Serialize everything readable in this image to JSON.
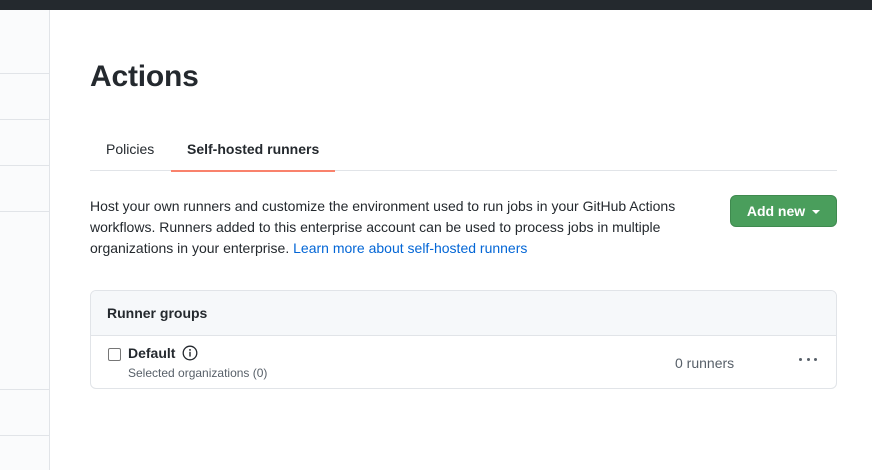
{
  "page": {
    "title": "Actions"
  },
  "tabs": [
    {
      "label": "Policies"
    },
    {
      "label": "Self-hosted runners"
    }
  ],
  "intro": {
    "text": "Host your own runners and customize the environment used to run jobs in your GitHub Actions workflows. Runners added to this enterprise account can be used to process jobs in multiple organizations in your enterprise.",
    "link": "Learn more about self-hosted runners"
  },
  "add_button": {
    "label": "Add new",
    "color": "#4a9e5c"
  },
  "runner_groups": {
    "header": "Runner groups",
    "rows": [
      {
        "name": "Default",
        "subtitle": "Selected organizations (0)",
        "count": "0 runners",
        "checked": false
      }
    ]
  },
  "colors": {
    "accent_underline": "#f9826c",
    "link": "#0366d6",
    "topbar": "#24292e"
  },
  "icons": [
    "info-icon",
    "caret-down-icon",
    "kebab-horizontal-icon"
  ]
}
